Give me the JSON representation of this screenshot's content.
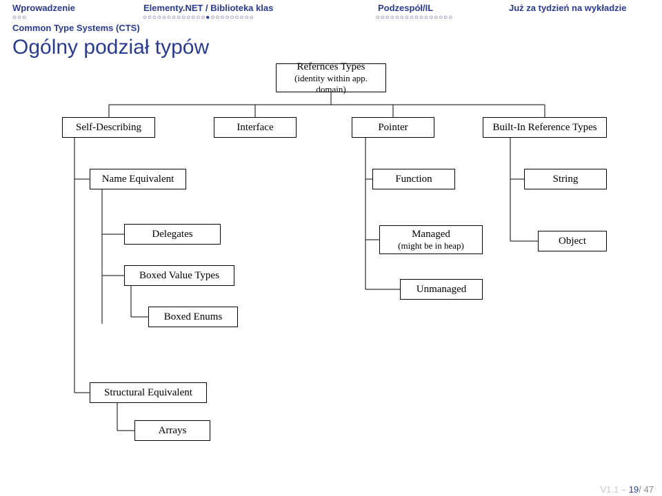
{
  "header": {
    "nav": [
      "Wprowadzenie",
      "Elementy.NET / Biblioteka klas",
      "Podzespół/IL",
      "Już za tydzień na wykładzie"
    ],
    "dots": [
      "○○○",
      "○○○○○○○○○○○○○●○○○○○○○○○",
      "○○○○○○○○○○○○○○○○",
      ""
    ],
    "subhead": "Common Type Systems (CTS)"
  },
  "title": "Ogólny podział typów",
  "nodes": {
    "root": {
      "line1": "Refernces Types",
      "line2": "(identity within app. domain)"
    },
    "selfdesc": "Self-Describing",
    "interface": "Interface",
    "pointer": "Pointer",
    "builtin": "Built-In Reference Types",
    "nameeq": "Name Equivalent",
    "function": "Function",
    "string": "String",
    "delegates": "Delegates",
    "managed": {
      "line1": "Managed",
      "line2": "(might be in heap)"
    },
    "object": "Object",
    "boxedval": "Boxed Value Types",
    "unmanaged": "Unmanaged",
    "boxedenum": "Boxed Enums",
    "structeq": "Structural Equivalent",
    "arrays": "Arrays"
  },
  "footer": {
    "ver": "V1.1 – ",
    "page": "19",
    "sep": "/ ",
    "total": "47"
  }
}
